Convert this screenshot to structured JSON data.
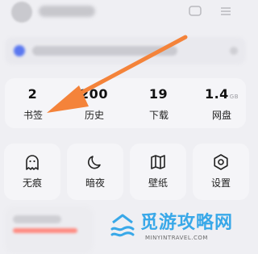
{
  "stats": [
    {
      "value": "2",
      "unit": "",
      "label": "书签"
    },
    {
      "value": "200",
      "unit": "",
      "label": "历史"
    },
    {
      "value": "19",
      "unit": "",
      "label": "下载"
    },
    {
      "value": "1.4",
      "unit": "GB",
      "label": "网盘"
    }
  ],
  "tiles": [
    {
      "label": "无痕",
      "icon": "ghost-icon"
    },
    {
      "label": "暗夜",
      "icon": "moon-icon"
    },
    {
      "label": "壁纸",
      "icon": "wallpaper-map-icon"
    },
    {
      "label": "设置",
      "icon": "gear-icon"
    }
  ],
  "watermark": {
    "title": "觅游攻略网",
    "subtitle": "MINYINTRAVEL.COM"
  },
  "colors": {
    "background": "#efeff3",
    "card": "#f5f5f8",
    "arrow": "#f4833a",
    "watermark": "#39a8e8"
  }
}
